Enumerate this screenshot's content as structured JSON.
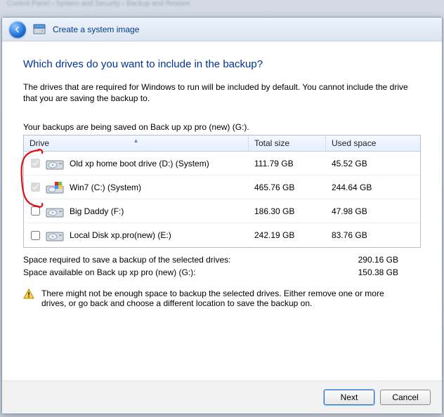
{
  "window": {
    "title": "Create a system image",
    "close_glyph": "✕"
  },
  "page": {
    "heading": "Which drives do you want to include in the backup?",
    "explain": "The drives that are required for Windows to run will be included by default. You cannot include the drive that you are saving the backup to.",
    "saving_line": "Your backups are being saved on Back up xp pro (new) (G:)."
  },
  "table": {
    "headers": {
      "drive": "Drive",
      "total": "Total size",
      "used": "Used space"
    },
    "rows": [
      {
        "checked": true,
        "disabled": true,
        "icon": "hdd",
        "label": "Old xp home boot drive (D:) (System)",
        "total": "111.79 GB",
        "used": "45.52 GB"
      },
      {
        "checked": true,
        "disabled": true,
        "icon": "winhdd",
        "label": "Win7 (C:) (System)",
        "total": "465.76 GB",
        "used": "244.64 GB"
      },
      {
        "checked": false,
        "disabled": false,
        "icon": "hdd",
        "label": "Big Daddy (F:)",
        "total": "186.30 GB",
        "used": "47.98 GB"
      },
      {
        "checked": false,
        "disabled": false,
        "icon": "hdd",
        "label": "Local Disk xp.pro(new) (E:)",
        "total": "242.19 GB",
        "used": "83.76 GB"
      }
    ]
  },
  "summary": {
    "required_label": "Space required to save a backup of the selected drives:",
    "required_value": "290.16 GB",
    "available_label": "Space available on Back up xp pro (new) (G:):",
    "available_value": "150.38 GB"
  },
  "warning": "There might not be enough space to backup the selected drives. Either remove one or more drives, or go back and choose a different location to save the backup on.",
  "buttons": {
    "next": "Next",
    "cancel": "Cancel"
  }
}
